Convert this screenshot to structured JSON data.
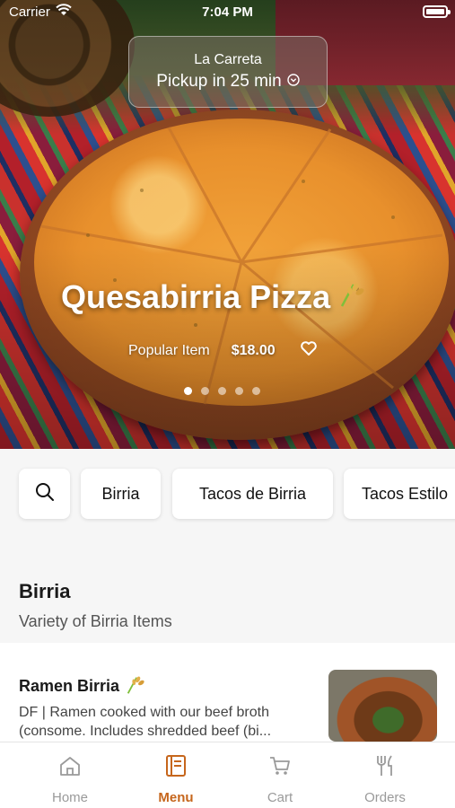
{
  "status_bar": {
    "carrier": "Carrier",
    "time": "7:04 PM"
  },
  "pickup": {
    "store": "La Carreta",
    "time_label": "Pickup in 25 min"
  },
  "hero": {
    "title": "Quesabirria Pizza",
    "tag": "Popular Item",
    "price": "$18.00",
    "carousel": {
      "count": 5,
      "active": 1
    }
  },
  "categories": [
    "Birria",
    "Tacos de Birria",
    "Tacos Estilo"
  ],
  "section": {
    "title": "Birria",
    "subtitle": "Variety of Birria Items"
  },
  "menu_item": {
    "name": "Ramen Birria",
    "desc_line1": "DF | Ramen cooked with our beef broth",
    "desc_line2": "(consome. Includes shredded beef (bi..."
  },
  "tabs": [
    {
      "label": "Home",
      "icon": "home-icon",
      "active": false
    },
    {
      "label": "Menu",
      "icon": "menu-icon",
      "active": true
    },
    {
      "label": "Cart",
      "icon": "cart-icon",
      "active": false
    },
    {
      "label": "Orders",
      "icon": "orders-icon",
      "active": false
    }
  ],
  "colors": {
    "accent": "#c6661c",
    "inactive": "#9a9a9a"
  }
}
